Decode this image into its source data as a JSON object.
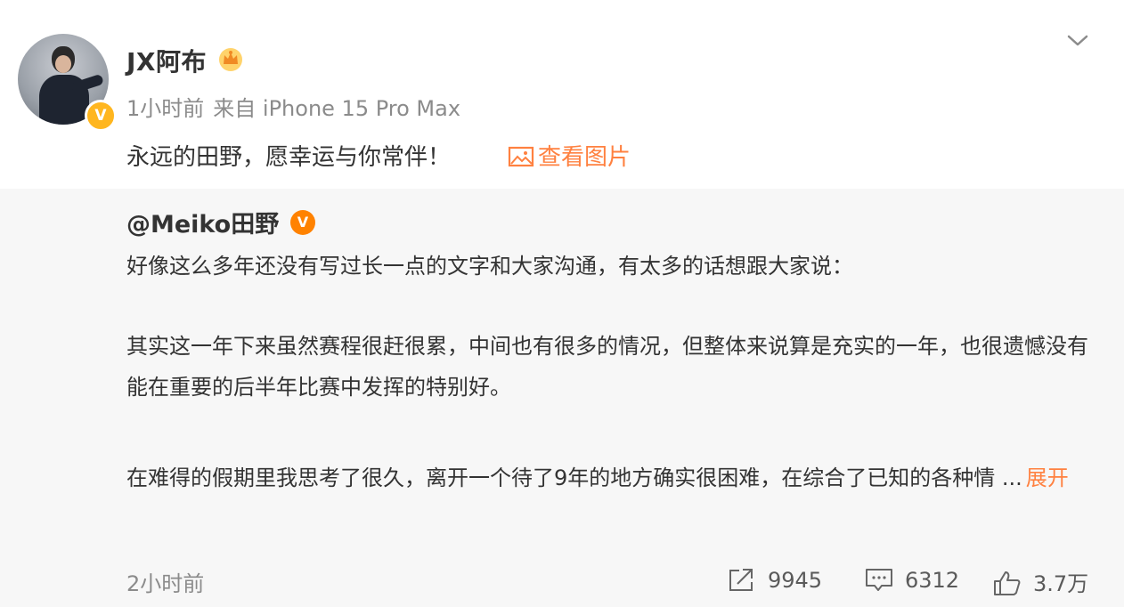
{
  "post": {
    "username": "JX阿布",
    "time": "1小时前",
    "source": "来自 iPhone 15 Pro Max",
    "text": "永远的田野，愿幸运与你常伴！",
    "view_image_label": "查看图片"
  },
  "repost": {
    "author": "@Meiko田野",
    "paragraphs": [
      "好像这么多年还没有写过长一点的文字和大家沟通，有太多的话想跟大家说：",
      "其实这一年下来虽然赛程很赶很累，中间也有很多的情况，但整体来说算是充实的一年，也很遗憾没有能在重要的后半年比赛中发挥的特别好。",
      "在难得的假期里我思考了很久，离开一个待了9年的地方确实很困难，在综合了已知的各种情 ..."
    ],
    "expand_label": "展开",
    "time": "2小时前",
    "reposts": "9945",
    "comments": "6312",
    "likes": "3.7万"
  },
  "icons": {
    "verified_user": "yellow-v-badge",
    "crown": "crown-icon",
    "repost_verified": "orange-v-badge",
    "menu": "chevron-down-icon",
    "image": "image-icon",
    "share": "share-icon",
    "comment": "comment-icon",
    "like": "thumbs-up-icon"
  },
  "colors": {
    "accent": "#ff8140",
    "meta_gray": "#8b8b8b",
    "repost_bg": "#f7f7f7",
    "verify_yellow": "#ffb61f",
    "verify_orange": "#ff8200"
  }
}
